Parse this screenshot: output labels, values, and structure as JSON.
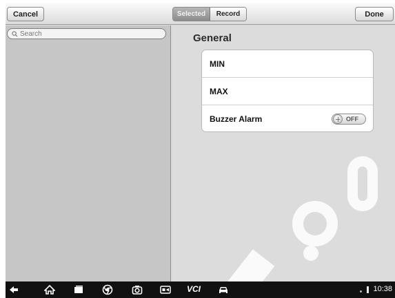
{
  "toolbar": {
    "cancel_label": "Cancel",
    "segment": {
      "selected_label": "Selected",
      "record_label": "Record",
      "active": "Selected"
    },
    "done_label": "Done"
  },
  "left_pane": {
    "search": {
      "placeholder": "Search",
      "value": ""
    }
  },
  "right_pane": {
    "section_title": "General",
    "rows": [
      {
        "label": "MIN"
      },
      {
        "label": "MAX"
      },
      {
        "label": "Buzzer Alarm",
        "toggle": "OFF"
      }
    ]
  },
  "navbar": {
    "icons": [
      "back-icon",
      "home-icon",
      "recent-apps-icon",
      "chrome-icon",
      "camera-icon",
      "screen-mirror-icon",
      "vci-icon",
      "car-icon"
    ],
    "vci_label": "VCI",
    "time": "10:38"
  }
}
